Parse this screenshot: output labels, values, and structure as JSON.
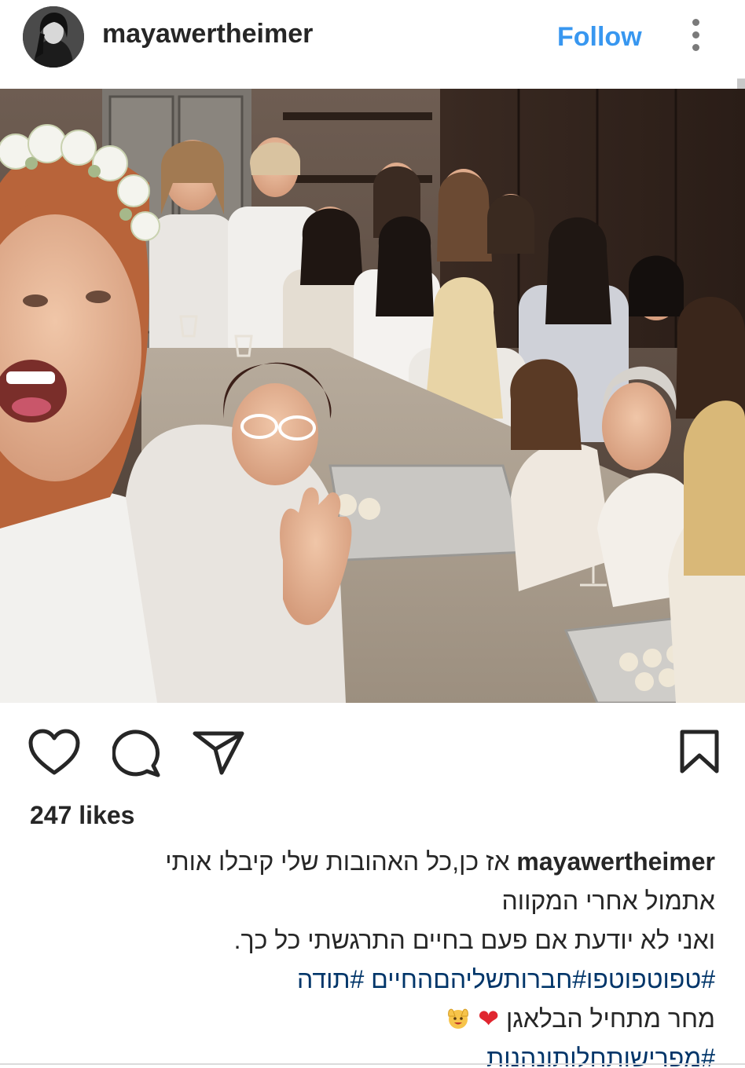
{
  "header": {
    "username": "mayawertheimer",
    "follow_label": "Follow"
  },
  "icons": {
    "avatar": "profile-avatar",
    "more": "more-vertical-icon",
    "like": "heart-outline-icon",
    "comment": "comment-bubble-icon",
    "share": "paper-plane-icon",
    "save": "bookmark-outline-icon"
  },
  "post": {
    "likes": "247 likes",
    "caption": {
      "username": "mayawertheimer",
      "line1": "אז כן,כל האהובות שלי קיבלו אותי",
      "line2": "אתמול אחרי המקווה",
      "line3": "ואני לא יודעת אם פעם בחיים התרגשתי כל כך.",
      "line4_hashtag_1": "#טפוטפוטפו",
      "line4_hashtag_2": "#חברותשליהםהחיים",
      "line4_hashtag_3": "#תודה",
      "line5_text": "מחר מתחיל הבלאגן",
      "line5_heart": "❤",
      "line5_tail": "🙌",
      "line6_hashtag": "#מפרישותחלותונהנות"
    }
  },
  "colors": {
    "follow": "#3897f0",
    "hashtag": "#003569",
    "text": "#262626"
  }
}
